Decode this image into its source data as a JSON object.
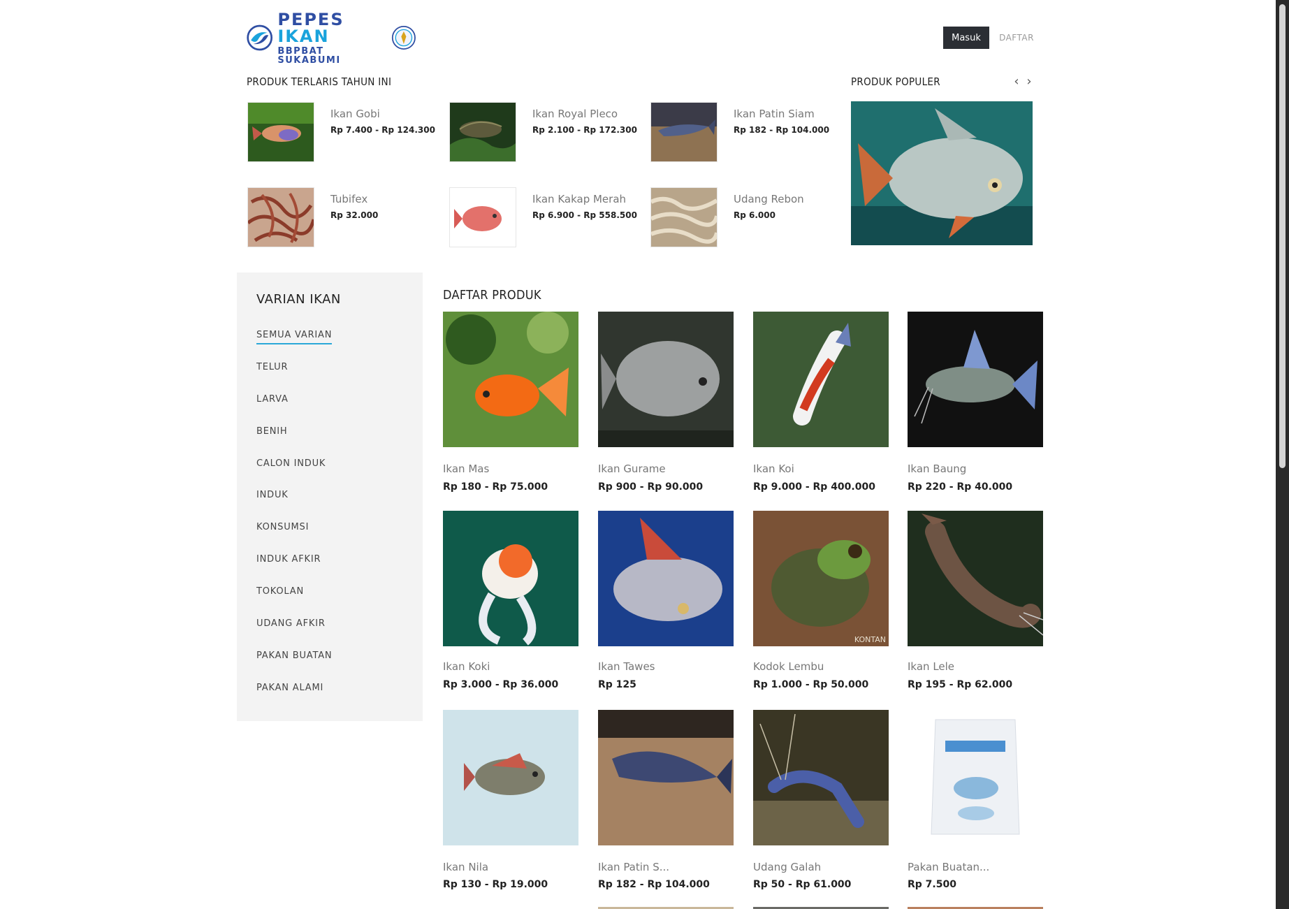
{
  "header": {
    "logo_line1": "PEPES IKAN",
    "logo_line2": "BBPBAT SUKABUMI",
    "login_label": "Masuk",
    "register_label": "DAFTAR"
  },
  "bestsellers": {
    "title": "PRODUK TERLARIS TAHUN INI",
    "items": [
      {
        "name": "Ikan Gobi",
        "price": "Rp 7.400 - Rp 124.300",
        "image": "fish-gobi"
      },
      {
        "name": "Ikan Royal Pleco",
        "price": "Rp 2.100 - Rp 172.300",
        "image": "fish-pleco"
      },
      {
        "name": "Ikan Patin Siam",
        "price": "Rp 182 - Rp 104.000",
        "image": "fish-patin"
      },
      {
        "name": "Tubifex",
        "price": "Rp 32.000",
        "image": "worms-tubifex"
      },
      {
        "name": "Ikan Kakap Merah",
        "price": "Rp 6.900 - Rp 558.500",
        "image": "fish-red-snapper"
      },
      {
        "name": "Udang Rebon",
        "price": "Rp 6.000",
        "image": "dried-shrimp"
      }
    ]
  },
  "popular": {
    "title": "PRODUK POPULER",
    "prev_icon": "chevron-left-icon",
    "next_icon": "chevron-right-icon",
    "image": "fish-tawes-popular"
  },
  "sidebar": {
    "title": "VARIAN IKAN",
    "items": [
      {
        "label": "SEMUA VARIAN",
        "active": true
      },
      {
        "label": "TELUR"
      },
      {
        "label": "LARVA"
      },
      {
        "label": "BENIH"
      },
      {
        "label": "CALON INDUK"
      },
      {
        "label": "INDUK"
      },
      {
        "label": "KONSUMSI"
      },
      {
        "label": "INDUK AFKIR"
      },
      {
        "label": "TOKOLAN"
      },
      {
        "label": "UDANG AFKIR"
      },
      {
        "label": "PAKAN BUATAN"
      },
      {
        "label": "PAKAN ALAMI"
      }
    ]
  },
  "products": {
    "title": "DAFTAR PRODUK",
    "items": [
      {
        "name": "Ikan Mas",
        "price": "Rp 180 - Rp 75.000",
        "image": "goldfish"
      },
      {
        "name": "Ikan Gurame",
        "price": "Rp 900 - Rp 90.000",
        "image": "gourami"
      },
      {
        "name": "Ikan Koi",
        "price": "Rp 9.000 - Rp 400.000",
        "image": "koi"
      },
      {
        "name": "Ikan Baung",
        "price": "Rp 220 - Rp 40.000",
        "image": "baung-catfish"
      },
      {
        "name": "Ikan Koki",
        "price": "Rp 3.000 - Rp 36.000",
        "image": "fancy-goldfish"
      },
      {
        "name": "Ikan Tawes",
        "price": "Rp 125",
        "image": "tawes"
      },
      {
        "name": "Kodok Lembu",
        "price": "Rp 1.000 - Rp 50.000",
        "image": "bullfrog",
        "watermark": "KONTAN"
      },
      {
        "name": "Ikan Lele",
        "price": "Rp 195 - Rp 62.000",
        "image": "lele-catfish"
      },
      {
        "name": "Ikan Nila",
        "price": "Rp 130 - Rp 19.000",
        "image": "tilapia"
      },
      {
        "name": "Ikan Patin S...",
        "price": "Rp 182 - Rp 104.000",
        "image": "patin"
      },
      {
        "name": "Udang Galah",
        "price": "Rp 50 - Rp 61.000",
        "image": "giant-prawn"
      },
      {
        "name": "Pakan Buatan...",
        "price": "Rp 7.500",
        "image": "feed-sack"
      }
    ]
  }
}
